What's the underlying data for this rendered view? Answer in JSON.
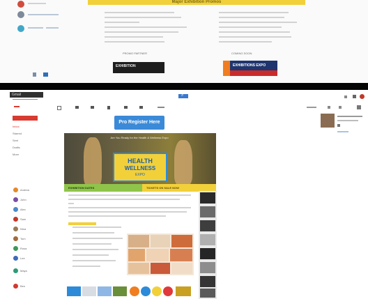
{
  "top_panel": {
    "banner_title": "Major Exhibition Promos",
    "left_promo_caption": "PROMO PARTNER",
    "right_promo_caption": "COMING SOON",
    "left_logo_text": "EXHIBITION",
    "right_logo_text": "EXHIBITIONS EXPO"
  },
  "mail_panel": {
    "brand_text": "Gmail",
    "search_button_label": "⌕",
    "cta_label": "Pro Register Here",
    "hero_title_small": "Are You Ready for the Health & Wellness Expo",
    "hero_logo_line1": "HEALTH",
    "hero_logo_line2": "WELLNESS",
    "hero_logo_line3": "EXPO",
    "hero_strip_left": "EXHIBITION DATES",
    "hero_strip_right": "TICKETS ON SALE NOW",
    "gray_menu": {
      "items": [
        "Inbox",
        "Starred",
        "Sent",
        "Drafts",
        "More"
      ]
    },
    "contacts": [
      "Andrea",
      "John",
      "Alex",
      "Sam",
      "Nina",
      "Tom",
      "Rosa",
      "Lee",
      "Maya",
      "Ben"
    ],
    "brand_colors": {
      "yellow": "#f2d03a",
      "blue_cta": "#3b8ad8",
      "red_compose": "#d93b30",
      "green_strip": "#8fc44a",
      "sidebar_bg": "#f6f6f6",
      "dark_bar": "#303030"
    }
  }
}
